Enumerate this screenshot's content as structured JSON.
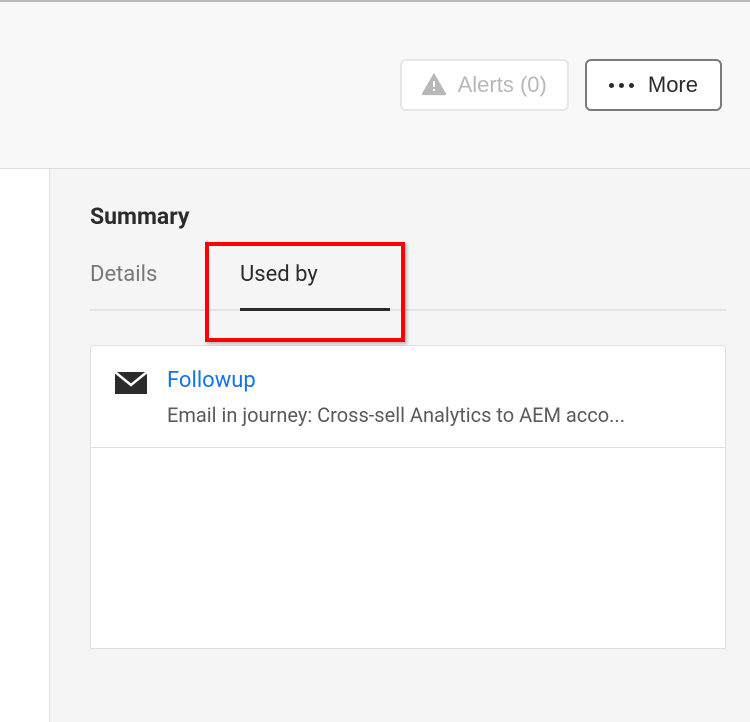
{
  "toolbar": {
    "alerts_label": "Alerts (0)",
    "more_label": "More"
  },
  "panel": {
    "summary_title": "Summary",
    "tabs": {
      "details": "Details",
      "used_by": "Used by"
    }
  },
  "usage": {
    "items": [
      {
        "title": "Followup",
        "description": "Email in journey: Cross-sell Analytics to AEM acco..."
      }
    ]
  }
}
